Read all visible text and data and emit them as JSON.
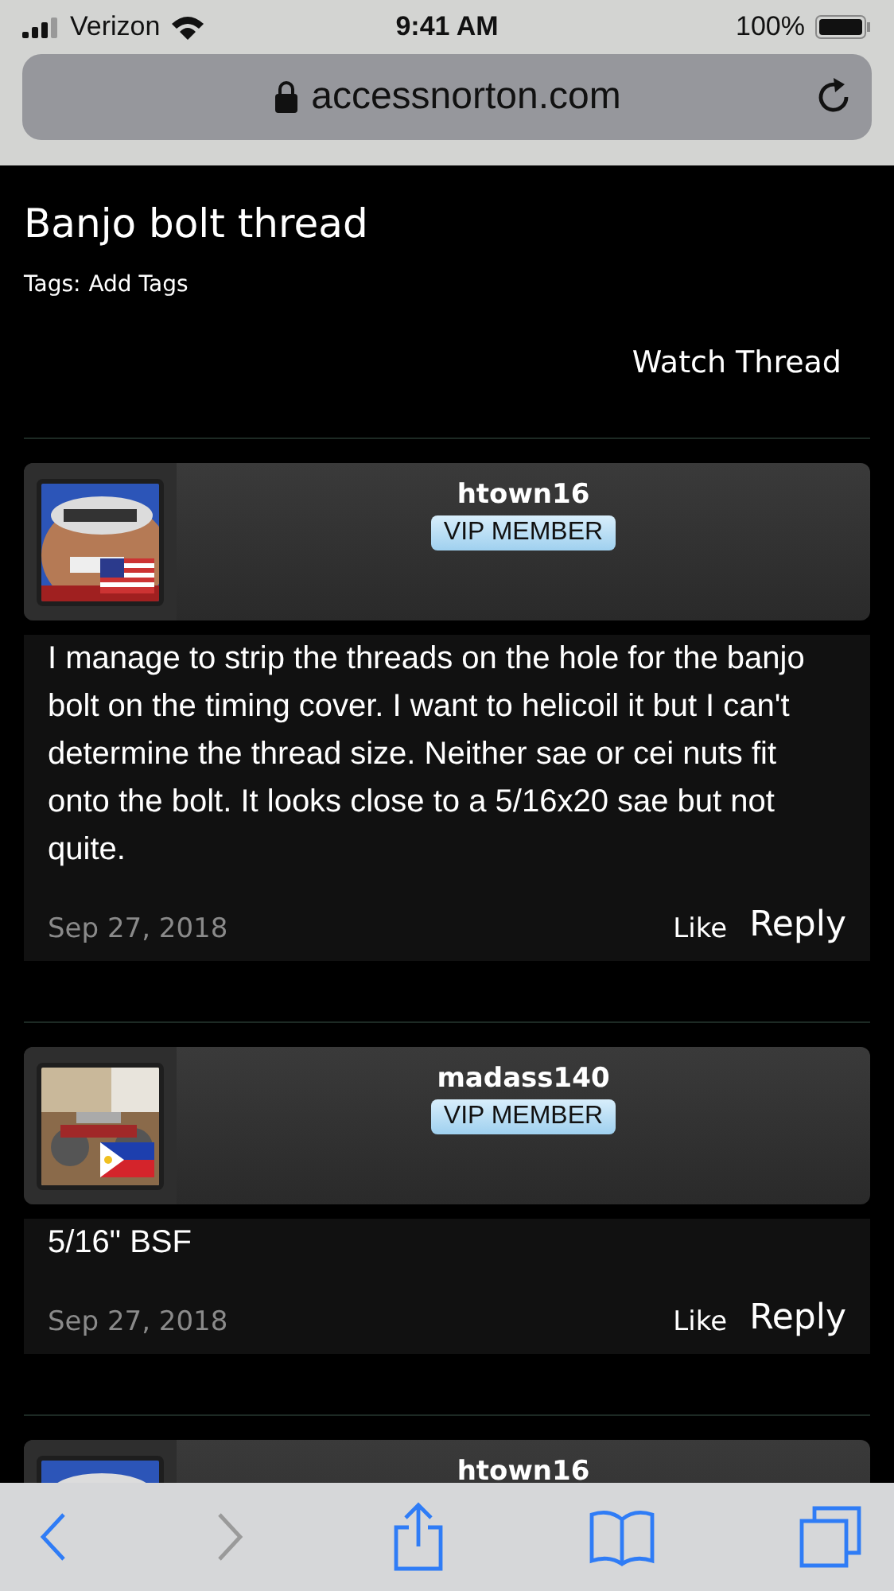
{
  "status_bar": {
    "carrier": "Verizon",
    "time": "9:41 AM",
    "battery": "100%"
  },
  "address_bar": {
    "url": "accessnorton.com"
  },
  "thread": {
    "title": "Banjo bolt thread",
    "tags_label": "Tags:",
    "add_tags": "Add Tags",
    "watch": "Watch Thread"
  },
  "posts": [
    {
      "user": "htown16",
      "badge": "VIP MEMBER",
      "flag": {
        "kind": "us"
      },
      "body": "I manage to strip the threads on the hole for the banjo bolt on the timing cover. I want to helicoil it but I can't determine the thread size. Neither sae or cei nuts fit onto the bolt. It looks close to a 5/16x20 sae but not quite.",
      "date": "Sep 27, 2018",
      "like": "Like",
      "reply": "Reply"
    },
    {
      "user": "madass140",
      "badge": "VIP MEMBER",
      "flag": {
        "kind": "ph"
      },
      "body": "5/16\" BSF",
      "date": "Sep 27, 2018",
      "like": "Like",
      "reply": "Reply"
    },
    {
      "user": "htown16"
    }
  ],
  "toolbar": [
    {
      "kind": "back",
      "disabled": false
    },
    {
      "kind": "forward",
      "disabled": true
    },
    {
      "kind": "share",
      "disabled": false
    },
    {
      "kind": "bookmarks",
      "disabled": false
    },
    {
      "kind": "tabs",
      "disabled": false
    }
  ]
}
